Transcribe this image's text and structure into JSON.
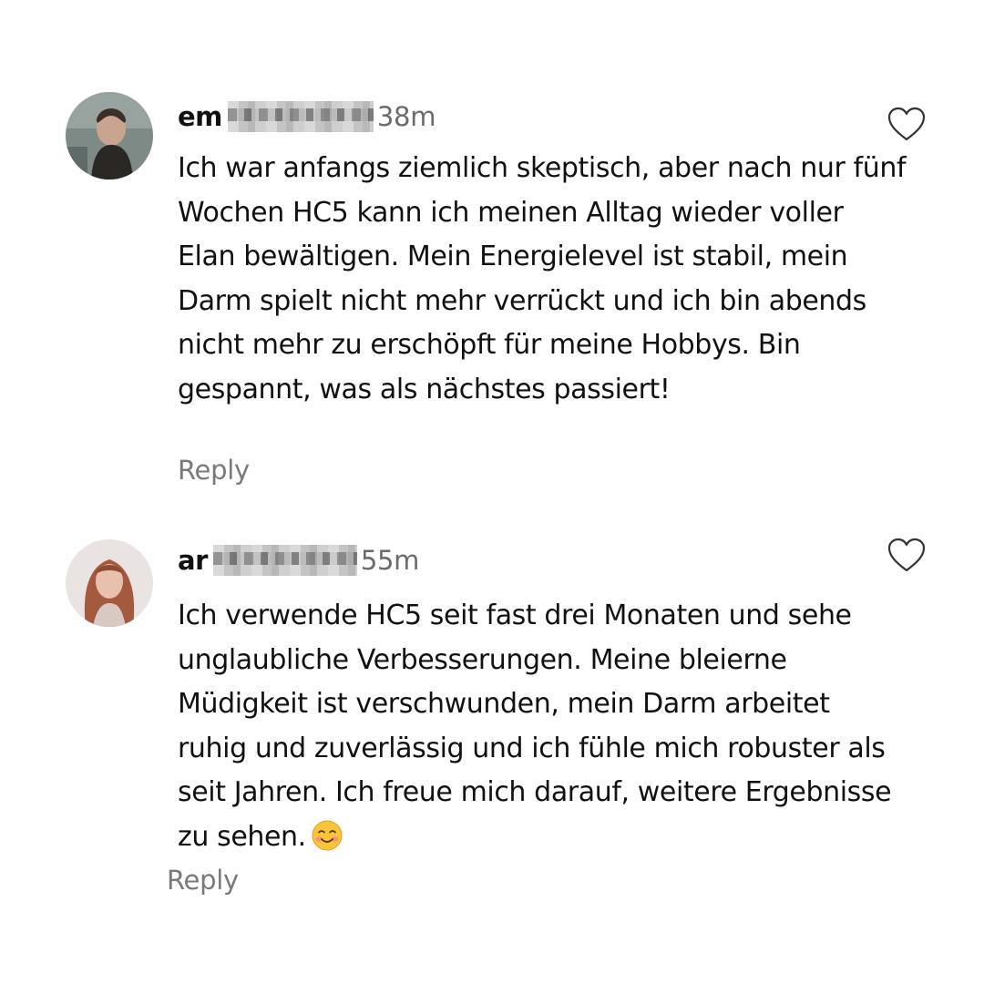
{
  "comments": [
    {
      "username": "em",
      "time": "38m",
      "text": "Ich war anfangs ziemlich skeptisch, aber nach nur fünf Wochen HC5 kann ich meinen Alltag wieder voller Elan bewältigen. Mein Energielevel ist stabil, mein Darm spielt nicht mehr verrückt und ich bin abends nicht mehr zu erschöpft für meine Hobbys. Bin gespannt, was als nächstes passiert!",
      "reply_label": "Reply",
      "liked": false
    },
    {
      "username": "ar",
      "time": "55m",
      "text": "Ich verwende HC5 seit fast drei Monaten und sehe unglaubliche Verbesserungen. Meine bleierne Müdigkeit ist verschwunden, mein Darm arbeitet ruhig und zuverlässig und ich fühle mich robuster als seit Jahren. Ich freue mich darauf, weitere Ergebnisse zu sehen.",
      "emoji": "smiling-face-with-smiling-eyes",
      "reply_label": "Reply",
      "liked": false
    }
  ],
  "colors": {
    "text": "#111111",
    "secondary": "#6b6b6b",
    "reply": "#7a7a7a",
    "background": "#ffffff"
  }
}
